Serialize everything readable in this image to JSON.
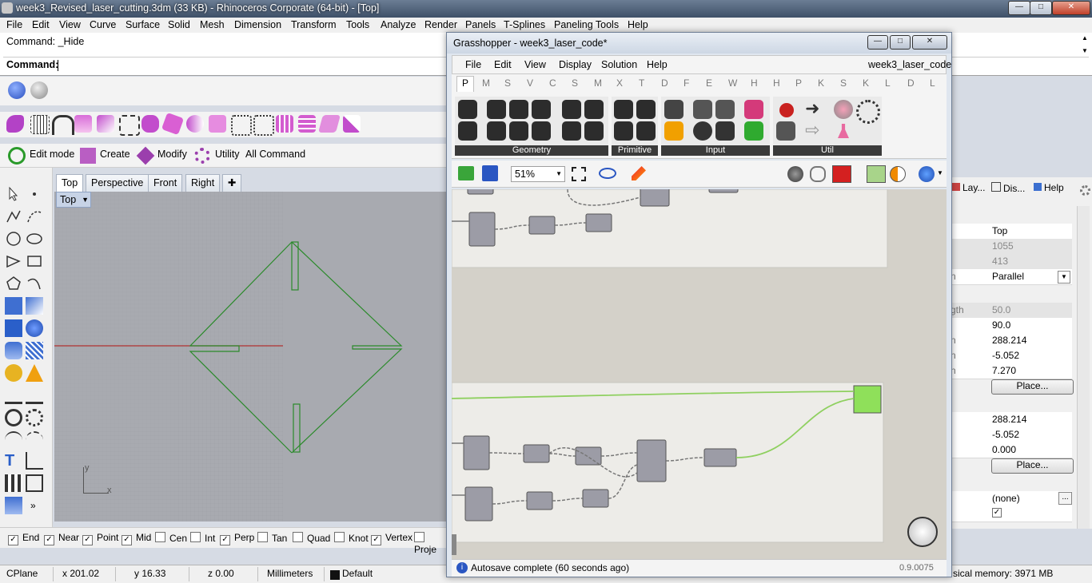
{
  "rhino": {
    "title": "week3_Revised_laser_cutting.3dm (33 KB) - Rhinoceros Corporate (64-bit) - [Top]",
    "menu": [
      "File",
      "Edit",
      "View",
      "Curve",
      "Surface",
      "Solid",
      "Mesh",
      "Dimension",
      "Transform",
      "Tools",
      "Analyze",
      "Render",
      "Panels",
      "T-Splines",
      "Paneling Tools",
      "Help"
    ],
    "command_history": "Command: _Hide",
    "command_prompt": "Command:",
    "cmd_tabs": {
      "edit_mode": "Edit mode",
      "create": "Create",
      "modify": "Modify",
      "utility": "Utility",
      "all_command": "All Command"
    },
    "viewport_tabs": [
      "Top",
      "Perspective",
      "Front",
      "Right"
    ],
    "viewport_label": "Top",
    "axis_labels": {
      "x": "x",
      "y": "y"
    },
    "osnaps": [
      {
        "label": "End",
        "checked": true
      },
      {
        "label": "Near",
        "checked": true
      },
      {
        "label": "Point",
        "checked": true
      },
      {
        "label": "Mid",
        "checked": true
      },
      {
        "label": "Cen",
        "checked": false
      },
      {
        "label": "Int",
        "checked": false
      },
      {
        "label": "Perp",
        "checked": true
      },
      {
        "label": "Tan",
        "checked": false
      },
      {
        "label": "Quad",
        "checked": false
      },
      {
        "label": "Knot",
        "checked": false
      },
      {
        "label": "Vertex",
        "checked": true
      },
      {
        "label": "Proje",
        "checked": false
      }
    ],
    "status": {
      "cplane": "CPlane",
      "x": "x 201.02",
      "y": "y 16.33",
      "z": "z 0.00",
      "units": "Millimeters",
      "layer": "Default",
      "memory": "sical memory: 3971 MB"
    }
  },
  "properties_panel": {
    "tabs": [
      "Lay...",
      "Dis...",
      "Help"
    ],
    "rows": [
      {
        "label": "",
        "value": "Top",
        "disabled": false
      },
      {
        "label": "",
        "value": "1055",
        "disabled": true
      },
      {
        "label": "",
        "value": "413",
        "disabled": true
      },
      {
        "label": "n",
        "value": "Parallel",
        "disabled": false,
        "dropdown": true
      },
      {
        "label": "gth",
        "value": "50.0",
        "disabled": true
      },
      {
        "label": "",
        "value": "90.0",
        "disabled": false
      },
      {
        "label": "n",
        "value": "288.214",
        "disabled": false
      },
      {
        "label": "n",
        "value": "-5.052",
        "disabled": false
      },
      {
        "label": "n",
        "value": "7.270",
        "disabled": false
      }
    ],
    "place_label": "Place...",
    "rows2": [
      "288.214",
      "-5.052",
      "0.000"
    ],
    "bottom_value": "(none)",
    "ellipsis": "..."
  },
  "grasshopper": {
    "title": "Grasshopper - week3_laser_code*",
    "menu": [
      "File",
      "Edit",
      "View",
      "Display",
      "Solution",
      "Help"
    ],
    "doc_name": "week3_laser_code",
    "tabs": [
      "P",
      "M",
      "S",
      "V",
      "C",
      "S",
      "M",
      "X",
      "T",
      "D",
      "F",
      "E",
      "W",
      "H",
      "H",
      "P",
      "K",
      "S",
      "K",
      "L",
      "D",
      "L"
    ],
    "groups": [
      "Geometry",
      "Primitive",
      "Input",
      "Util"
    ],
    "zoom": "51%",
    "status": "Autosave complete (60 seconds ago)",
    "version": "0.9.0075"
  }
}
